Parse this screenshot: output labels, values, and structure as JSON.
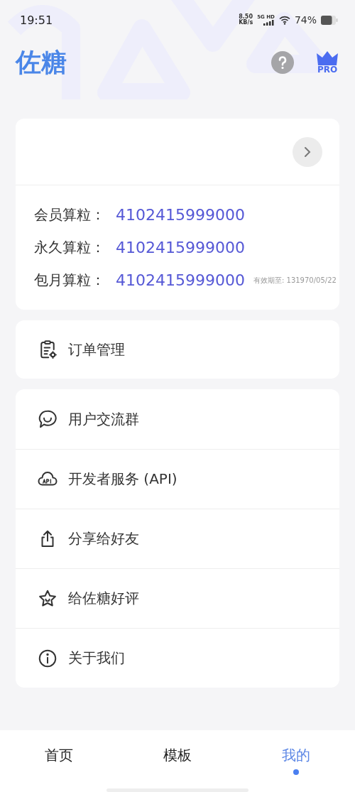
{
  "status_bar": {
    "time": "19:51",
    "speed": "8.50",
    "speed_unit": "KB/s",
    "network": "5G HD",
    "battery": "74%"
  },
  "header": {
    "title": "佐糖",
    "pro_badge": "PRO"
  },
  "balance": {
    "rows": [
      {
        "label": "会员算粒：",
        "value": "4102415999000"
      },
      {
        "label": "永久算粒：",
        "value": "4102415999000"
      },
      {
        "label": "包月算粒：",
        "value": "4102415999000",
        "note": "有效期至: 131970/05/22"
      }
    ]
  },
  "orders": {
    "label": "订单管理"
  },
  "menu": [
    {
      "label": "用户交流群"
    },
    {
      "label": "开发者服务 (API)"
    },
    {
      "label": "分享给好友"
    },
    {
      "label": "给佐糖好评"
    },
    {
      "label": "关于我们"
    }
  ],
  "tabs": [
    {
      "label": "首页",
      "selected": false
    },
    {
      "label": "模板",
      "selected": false
    },
    {
      "label": "我的",
      "selected": true
    }
  ]
}
